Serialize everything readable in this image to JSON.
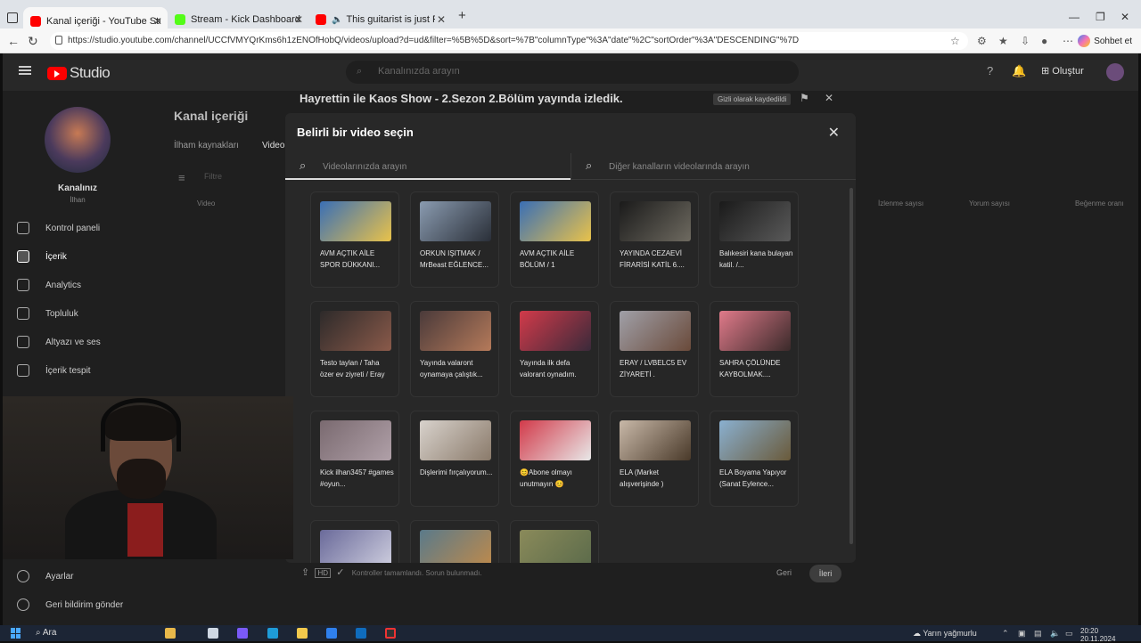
{
  "browser": {
    "tabs": [
      {
        "label": "Kanal içeriği - YouTube Studio",
        "active": true,
        "favicon_color": "#ff0000"
      },
      {
        "label": "Stream - Kick Dashboard",
        "active": false,
        "favicon_color": "#53fc18"
      },
      {
        "label": "This guitarist is just Ridiculo",
        "active": false,
        "favicon_color": "#ff0000"
      }
    ],
    "url": "https://studio.youtube.com/channel/UCCfVMYQrKms6h1zENOfHobQ/videos/upload?d=ud&filter=%5B%5D&sort=%7B\"columnType\"%3A\"date\"%2C\"sortOrder\"%3A\"DESCENDING\"%7D",
    "sohbet_label": "Sohbet et",
    "new_tab_icon": "+"
  },
  "studio": {
    "logo_text": "Studio",
    "search_placeholder": "Kanalınızda arayın",
    "create_label": "Oluştur"
  },
  "sidebar": {
    "channel_name": "Kanalınız",
    "channel_sub": "İlhan",
    "items": [
      {
        "label": "Kontrol paneli",
        "icon": "dashboard-icon"
      },
      {
        "label": "İçerik",
        "icon": "content-icon",
        "active": true
      },
      {
        "label": "Analytics",
        "icon": "analytics-icon"
      },
      {
        "label": "Topluluk",
        "icon": "community-icon"
      },
      {
        "label": "Altyazı ve ses",
        "icon": "subtitles-icon"
      },
      {
        "label": "İçerik tespit",
        "icon": "copyright-icon"
      }
    ],
    "footer": [
      {
        "label": "Ayarlar",
        "icon": "settings-icon"
      },
      {
        "label": "Geri bildirim gönder",
        "icon": "feedback-icon"
      }
    ]
  },
  "page": {
    "title": "Kanal içeriği",
    "tabs": [
      "İlham kaynakları",
      "Video"
    ],
    "filter_label": "Filtre",
    "col_video": "Video",
    "col_views": "İzlenme sayısı",
    "col_comments": "Yorum sayısı",
    "col_likes": "Beğenme oranı"
  },
  "upload_dialog": {
    "title": "Hayrettin ile Kaos Show - 2.Sezon 2.Bölüm yayında izledik.",
    "saved_badge": "Gizli olarak kaydedildi",
    "status": "Kontroller tamamlandı. Sorun bulunmadı.",
    "back_label": "Geri",
    "next_label": "İleri"
  },
  "modal": {
    "title": "Belirli bir video seçin",
    "search_own_placeholder": "Videolarınızda arayın",
    "search_other_placeholder": "Diğer kanalların videolarında arayın",
    "videos": [
      {
        "title": "AVM AÇTIK AİLE SPOR DÜKKANI...",
        "thumb": [
          "#3a6fb5",
          "#e9c24a"
        ]
      },
      {
        "title": "ORKUN IŞITMAK / MrBeast EĞLENCE...",
        "thumb": [
          "#8a9bb0",
          "#2a2f38"
        ]
      },
      {
        "title": "AVM AÇTIK AİLE BÖLÜM / 1",
        "thumb": [
          "#3a6fb5",
          "#e9c24a"
        ]
      },
      {
        "title": "YAYINDA CEZAEVİ FİRARİSİ KATİL 6....",
        "thumb": [
          "#1a1a1a",
          "#6e6a60"
        ]
      },
      {
        "title": "Balıkesiri kana bulayan katil. /...",
        "thumb": [
          "#1a1a1a",
          "#5a5a5a"
        ]
      },
      {
        "title": "Testo taylan / Taha özer ev ziyreti / Eray",
        "thumb": [
          "#2d2a2a",
          "#8a5a4a"
        ]
      },
      {
        "title": "Yayında valaront oynamaya çalıştık...",
        "thumb": [
          "#4a3a3a",
          "#b57a5a"
        ]
      },
      {
        "title": "Yayında ilk defa valorant oynadım.",
        "thumb": [
          "#d23a4a",
          "#3a2a3a"
        ]
      },
      {
        "title": "ERAY / LVBELC5 EV ZİYARETİ .",
        "thumb": [
          "#a0a0a8",
          "#6a4a3a"
        ]
      },
      {
        "title": "SAHRA ÇÖLÜNDE KAYBOLMAK....",
        "thumb": [
          "#e07a8a",
          "#3a2a2a"
        ]
      },
      {
        "title": "Kick ilhan3457 #games #oyun...",
        "thumb": [
          "#7a6a70",
          "#b0a0a8"
        ]
      },
      {
        "title": "Dişlerimi fırçalıyorum...",
        "thumb": [
          "#d8d2cc",
          "#8a7a6a"
        ]
      },
      {
        "title": "😊Abone olmayı unutmayın 😊",
        "thumb": [
          "#d23a4a",
          "#e8e8e8"
        ]
      },
      {
        "title": "ELA (Market alışverişinde )",
        "thumb": [
          "#c8b8a8",
          "#4a3a2a"
        ]
      },
      {
        "title": "ELA Boyama Yapıyor (Sanat Eylence...",
        "thumb": [
          "#8ab0d0",
          "#6a5a3a"
        ]
      },
      {
        "title": "",
        "thumb": [
          "#6a6a9a",
          "#d0d0e0"
        ]
      },
      {
        "title": "",
        "thumb": [
          "#5a7a8a",
          "#c08a4a"
        ]
      },
      {
        "title": "",
        "thumb": [
          "#8a8a5a",
          "#5a6a4a"
        ]
      }
    ]
  },
  "taskbar": {
    "search_label": "Ara",
    "weather": "Yarın yağmurlu",
    "time": "20:20",
    "date": "20.11.2024"
  }
}
